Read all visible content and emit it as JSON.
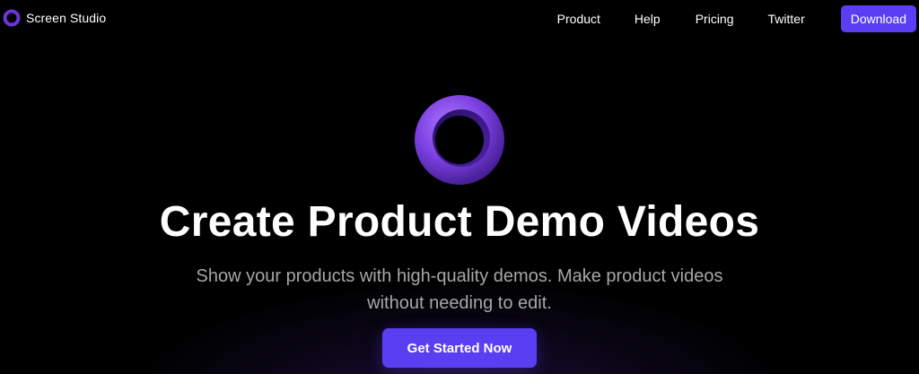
{
  "nav": {
    "brand_name": "Screen Studio",
    "links": [
      {
        "label": "Product"
      },
      {
        "label": "Help"
      },
      {
        "label": "Pricing"
      },
      {
        "label": "Twitter"
      }
    ],
    "download_label": "Download"
  },
  "hero": {
    "logo_icon": "ring-logo-icon",
    "headline": "Create Product Demo Videos",
    "subtitle": "Show your products with high-quality demos. Make product videos without needing to edit.",
    "cta_label": "Get Started Now"
  },
  "colors": {
    "background": "#000000",
    "accent": "#5a3ff2",
    "logo_purple": "#7a3fe0",
    "subtitle_gray": "#a7a7a7"
  }
}
